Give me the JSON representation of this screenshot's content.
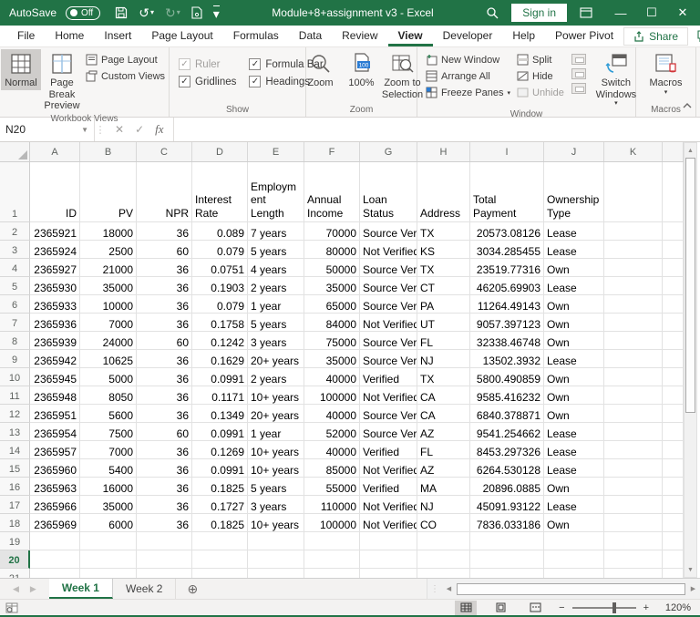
{
  "titlebar": {
    "autosave_label": "AutoSave",
    "autosave_state": "Off",
    "title": "Module+8+assignment v3 - Excel",
    "sign_in_label": "Sign in"
  },
  "ribbon": {
    "tabs": [
      "File",
      "Home",
      "Insert",
      "Page Layout",
      "Formulas",
      "Data",
      "Review",
      "View",
      "Developer",
      "Help",
      "Power Pivot"
    ],
    "active_tab": "View",
    "share_label": "Share",
    "groups": {
      "workbook_views": {
        "label": "Workbook Views",
        "normal": "Normal",
        "page_break_preview": "Page Break Preview",
        "page_layout": "Page Layout",
        "custom_views": "Custom Views"
      },
      "show": {
        "label": "Show",
        "ruler": "Ruler",
        "formula_bar": "Formula Bar",
        "gridlines": "Gridlines",
        "headings": "Headings"
      },
      "zoom": {
        "label": "Zoom",
        "zoom": "Zoom",
        "hundred": "100%",
        "zoom_to_selection": "Zoom to Selection"
      },
      "window": {
        "label": "Window",
        "new_window": "New Window",
        "arrange_all": "Arrange All",
        "freeze_panes": "Freeze Panes",
        "split": "Split",
        "hide": "Hide",
        "unhide": "Unhide",
        "switch_windows": "Switch Windows"
      },
      "macros": {
        "label": "Macros",
        "macros": "Macros"
      }
    }
  },
  "formula_bar": {
    "name_box": "N20",
    "formula_value": ""
  },
  "grid": {
    "visible_columns": [
      "A",
      "B",
      "C",
      "D",
      "E",
      "F",
      "G",
      "H",
      "I",
      "J",
      "K"
    ],
    "headers": [
      "ID",
      "PV",
      "NPR",
      "Interest Rate",
      "Employment Length",
      "Annual Income",
      "Loan Status",
      "Address",
      "Total Payment",
      "Ownership Type"
    ],
    "first_data_row": 2,
    "selected_cell": "N20",
    "selected_row": 20,
    "rows": [
      [
        "2365921",
        "18000",
        "36",
        "0.089",
        "7 years",
        "70000",
        "Source Verified",
        "TX",
        "20573.08126",
        "Lease"
      ],
      [
        "2365924",
        "2500",
        "60",
        "0.079",
        "5 years",
        "80000",
        "Not Verified",
        "KS",
        "3034.285455",
        "Lease"
      ],
      [
        "2365927",
        "21000",
        "36",
        "0.0751",
        "4 years",
        "50000",
        "Source Verified",
        "TX",
        "23519.77316",
        "Own"
      ],
      [
        "2365930",
        "35000",
        "36",
        "0.1903",
        "2 years",
        "35000",
        "Source Verified",
        "CT",
        "46205.69903",
        "Lease"
      ],
      [
        "2365933",
        "10000",
        "36",
        "0.079",
        "1 year",
        "65000",
        "Source Verified",
        "PA",
        "11264.49143",
        "Own"
      ],
      [
        "2365936",
        "7000",
        "36",
        "0.1758",
        "5 years",
        "84000",
        "Not Verified",
        "UT",
        "9057.397123",
        "Own"
      ],
      [
        "2365939",
        "24000",
        "60",
        "0.1242",
        "3 years",
        "75000",
        "Source Verified",
        "FL",
        "32338.46748",
        "Own"
      ],
      [
        "2365942",
        "10625",
        "36",
        "0.1629",
        "20+ years",
        "35000",
        "Source Verified",
        "NJ",
        "13502.3932",
        "Lease"
      ],
      [
        "2365945",
        "5000",
        "36",
        "0.0991",
        "2 years",
        "40000",
        "Verified",
        "TX",
        "5800.490859",
        "Own"
      ],
      [
        "2365948",
        "8050",
        "36",
        "0.1171",
        "10+ years",
        "100000",
        "Not Verified",
        "CA",
        "9585.416232",
        "Own"
      ],
      [
        "2365951",
        "5600",
        "36",
        "0.1349",
        "20+ years",
        "40000",
        "Source Verified",
        "CA",
        "6840.378871",
        "Own"
      ],
      [
        "2365954",
        "7500",
        "60",
        "0.0991",
        "1 year",
        "52000",
        "Source Verified",
        "AZ",
        "9541.254662",
        "Lease"
      ],
      [
        "2365957",
        "7000",
        "36",
        "0.1269",
        "10+ years",
        "40000",
        "Verified",
        "FL",
        "8453.297326",
        "Lease"
      ],
      [
        "2365960",
        "5400",
        "36",
        "0.0991",
        "10+ years",
        "85000",
        "Not Verified",
        "AZ",
        "6264.530128",
        "Lease"
      ],
      [
        "2365963",
        "16000",
        "36",
        "0.1825",
        "5 years",
        "55000",
        "Verified",
        "MA",
        "20896.0885",
        "Own"
      ],
      [
        "2365966",
        "35000",
        "36",
        "0.1727",
        "3 years",
        "110000",
        "Not Verified",
        "NJ",
        "45091.93122",
        "Lease"
      ],
      [
        "2365969",
        "6000",
        "36",
        "0.1825",
        "10+ years",
        "100000",
        "Not Verified",
        "CO",
        "7836.033186",
        "Own"
      ]
    ],
    "trailing_empty_rows": [
      19,
      20,
      21
    ]
  },
  "sheet_tabs": {
    "tabs": [
      "Week 1",
      "Week 2"
    ],
    "active": "Week 1"
  },
  "status_bar": {
    "zoom_level": "120%"
  },
  "colors": {
    "excel_green": "#217346",
    "badge_blue": "#2b7cd3",
    "macro_red": "#d13438",
    "normal_selected_bg": "#cfcdcb"
  }
}
